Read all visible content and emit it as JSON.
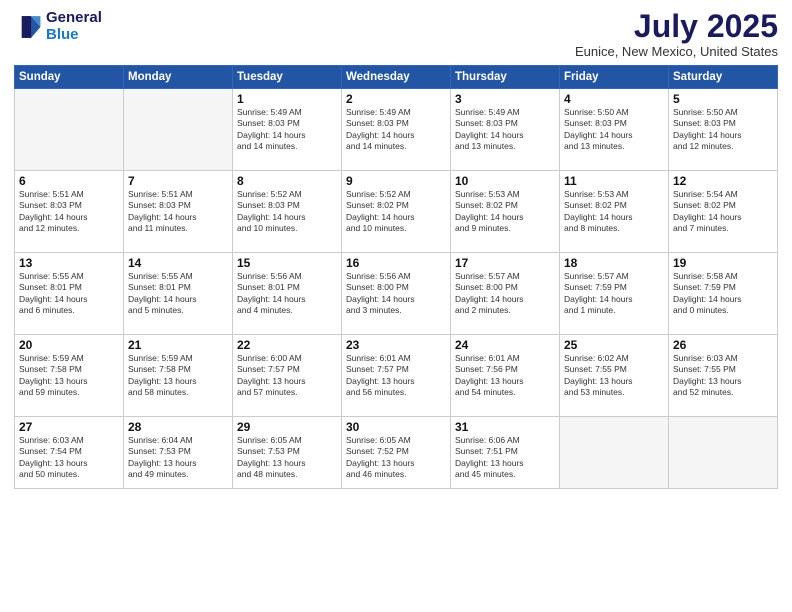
{
  "header": {
    "logo_line1": "General",
    "logo_line2": "Blue",
    "month": "July 2025",
    "location": "Eunice, New Mexico, United States"
  },
  "weekdays": [
    "Sunday",
    "Monday",
    "Tuesday",
    "Wednesday",
    "Thursday",
    "Friday",
    "Saturday"
  ],
  "weeks": [
    [
      {
        "day": "",
        "info": ""
      },
      {
        "day": "",
        "info": ""
      },
      {
        "day": "1",
        "info": "Sunrise: 5:49 AM\nSunset: 8:03 PM\nDaylight: 14 hours\nand 14 minutes."
      },
      {
        "day": "2",
        "info": "Sunrise: 5:49 AM\nSunset: 8:03 PM\nDaylight: 14 hours\nand 14 minutes."
      },
      {
        "day": "3",
        "info": "Sunrise: 5:49 AM\nSunset: 8:03 PM\nDaylight: 14 hours\nand 13 minutes."
      },
      {
        "day": "4",
        "info": "Sunrise: 5:50 AM\nSunset: 8:03 PM\nDaylight: 14 hours\nand 13 minutes."
      },
      {
        "day": "5",
        "info": "Sunrise: 5:50 AM\nSunset: 8:03 PM\nDaylight: 14 hours\nand 12 minutes."
      }
    ],
    [
      {
        "day": "6",
        "info": "Sunrise: 5:51 AM\nSunset: 8:03 PM\nDaylight: 14 hours\nand 12 minutes."
      },
      {
        "day": "7",
        "info": "Sunrise: 5:51 AM\nSunset: 8:03 PM\nDaylight: 14 hours\nand 11 minutes."
      },
      {
        "day": "8",
        "info": "Sunrise: 5:52 AM\nSunset: 8:03 PM\nDaylight: 14 hours\nand 10 minutes."
      },
      {
        "day": "9",
        "info": "Sunrise: 5:52 AM\nSunset: 8:02 PM\nDaylight: 14 hours\nand 10 minutes."
      },
      {
        "day": "10",
        "info": "Sunrise: 5:53 AM\nSunset: 8:02 PM\nDaylight: 14 hours\nand 9 minutes."
      },
      {
        "day": "11",
        "info": "Sunrise: 5:53 AM\nSunset: 8:02 PM\nDaylight: 14 hours\nand 8 minutes."
      },
      {
        "day": "12",
        "info": "Sunrise: 5:54 AM\nSunset: 8:02 PM\nDaylight: 14 hours\nand 7 minutes."
      }
    ],
    [
      {
        "day": "13",
        "info": "Sunrise: 5:55 AM\nSunset: 8:01 PM\nDaylight: 14 hours\nand 6 minutes."
      },
      {
        "day": "14",
        "info": "Sunrise: 5:55 AM\nSunset: 8:01 PM\nDaylight: 14 hours\nand 5 minutes."
      },
      {
        "day": "15",
        "info": "Sunrise: 5:56 AM\nSunset: 8:01 PM\nDaylight: 14 hours\nand 4 minutes."
      },
      {
        "day": "16",
        "info": "Sunrise: 5:56 AM\nSunset: 8:00 PM\nDaylight: 14 hours\nand 3 minutes."
      },
      {
        "day": "17",
        "info": "Sunrise: 5:57 AM\nSunset: 8:00 PM\nDaylight: 14 hours\nand 2 minutes."
      },
      {
        "day": "18",
        "info": "Sunrise: 5:57 AM\nSunset: 7:59 PM\nDaylight: 14 hours\nand 1 minute."
      },
      {
        "day": "19",
        "info": "Sunrise: 5:58 AM\nSunset: 7:59 PM\nDaylight: 14 hours\nand 0 minutes."
      }
    ],
    [
      {
        "day": "20",
        "info": "Sunrise: 5:59 AM\nSunset: 7:58 PM\nDaylight: 13 hours\nand 59 minutes."
      },
      {
        "day": "21",
        "info": "Sunrise: 5:59 AM\nSunset: 7:58 PM\nDaylight: 13 hours\nand 58 minutes."
      },
      {
        "day": "22",
        "info": "Sunrise: 6:00 AM\nSunset: 7:57 PM\nDaylight: 13 hours\nand 57 minutes."
      },
      {
        "day": "23",
        "info": "Sunrise: 6:01 AM\nSunset: 7:57 PM\nDaylight: 13 hours\nand 56 minutes."
      },
      {
        "day": "24",
        "info": "Sunrise: 6:01 AM\nSunset: 7:56 PM\nDaylight: 13 hours\nand 54 minutes."
      },
      {
        "day": "25",
        "info": "Sunrise: 6:02 AM\nSunset: 7:55 PM\nDaylight: 13 hours\nand 53 minutes."
      },
      {
        "day": "26",
        "info": "Sunrise: 6:03 AM\nSunset: 7:55 PM\nDaylight: 13 hours\nand 52 minutes."
      }
    ],
    [
      {
        "day": "27",
        "info": "Sunrise: 6:03 AM\nSunset: 7:54 PM\nDaylight: 13 hours\nand 50 minutes."
      },
      {
        "day": "28",
        "info": "Sunrise: 6:04 AM\nSunset: 7:53 PM\nDaylight: 13 hours\nand 49 minutes."
      },
      {
        "day": "29",
        "info": "Sunrise: 6:05 AM\nSunset: 7:53 PM\nDaylight: 13 hours\nand 48 minutes."
      },
      {
        "day": "30",
        "info": "Sunrise: 6:05 AM\nSunset: 7:52 PM\nDaylight: 13 hours\nand 46 minutes."
      },
      {
        "day": "31",
        "info": "Sunrise: 6:06 AM\nSunset: 7:51 PM\nDaylight: 13 hours\nand 45 minutes."
      },
      {
        "day": "",
        "info": ""
      },
      {
        "day": "",
        "info": ""
      }
    ]
  ]
}
